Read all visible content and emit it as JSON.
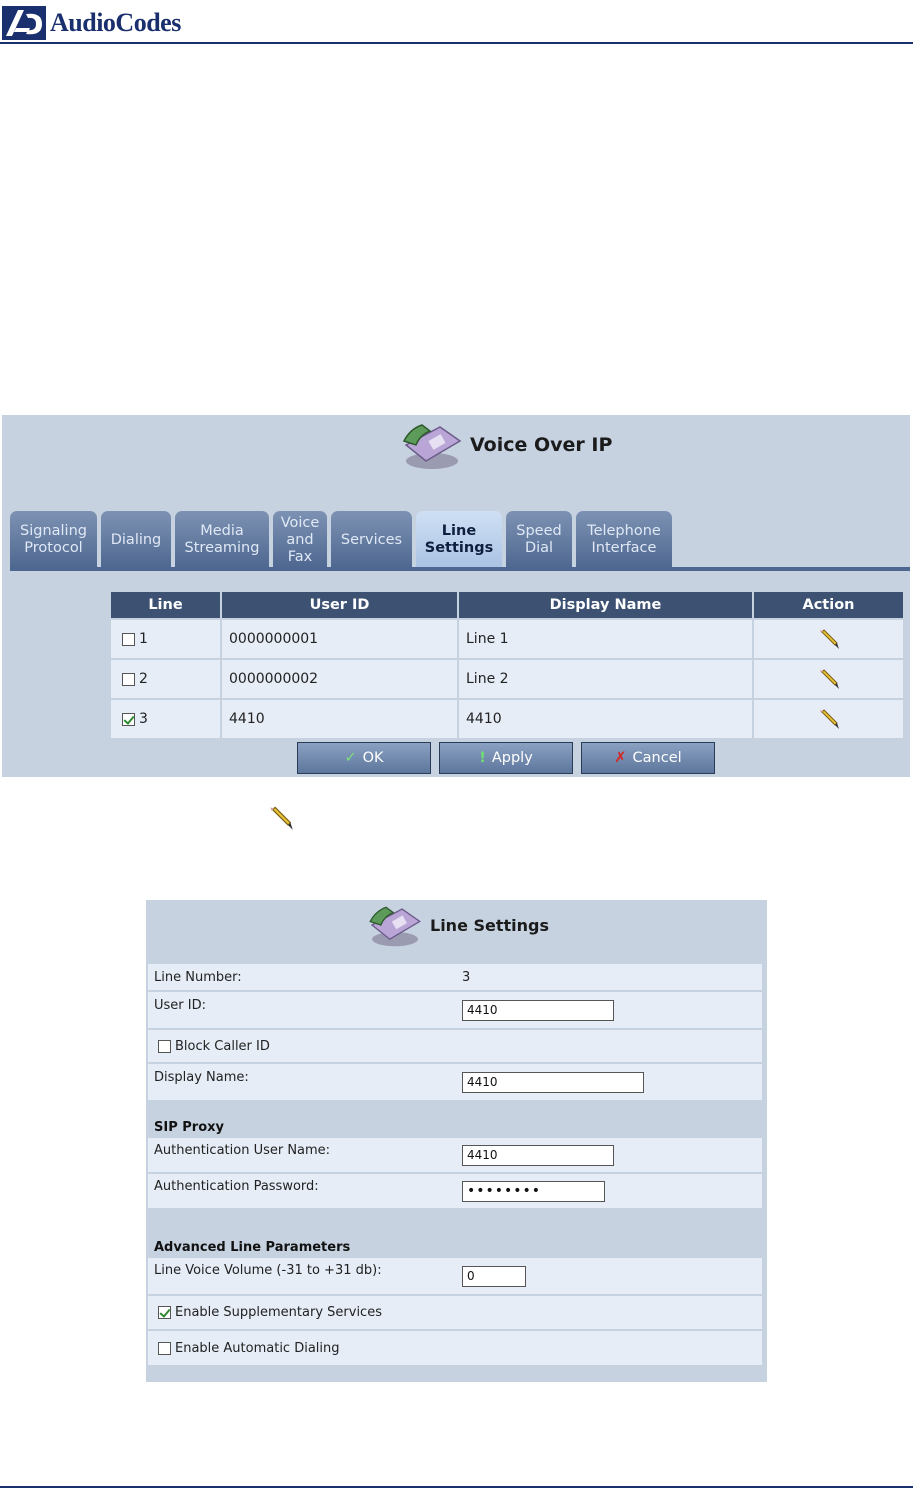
{
  "header": {
    "brand": "AudioCodes"
  },
  "voip": {
    "title": "Voice Over IP",
    "tabs": [
      {
        "label": "Signaling\nProtocol",
        "active": false
      },
      {
        "label": "Dialing",
        "active": false
      },
      {
        "label": "Media\nStreaming",
        "active": false
      },
      {
        "label": "Voice\nand\nFax",
        "active": false
      },
      {
        "label": "Services",
        "active": false
      },
      {
        "label": "Line\nSettings",
        "active": true
      },
      {
        "label": "Speed\nDial",
        "active": false
      },
      {
        "label": "Telephone\nInterface",
        "active": false
      }
    ],
    "table": {
      "headers": [
        "Line",
        "User ID",
        "Display Name",
        "Action"
      ],
      "rows": [
        {
          "line": "1",
          "checked": false,
          "user_id": "0000000001",
          "display_name": "Line 1"
        },
        {
          "line": "2",
          "checked": false,
          "user_id": "0000000002",
          "display_name": "Line 2"
        },
        {
          "line": "3",
          "checked": true,
          "user_id": "4410",
          "display_name": "4410"
        }
      ]
    },
    "buttons": {
      "ok": "OK",
      "apply": "Apply",
      "cancel": "Cancel"
    }
  },
  "line_settings": {
    "title": "Line Settings",
    "line_number_label": "Line Number:",
    "line_number_value": "3",
    "user_id_label": "User ID:",
    "user_id_value": "4410",
    "block_caller_id_label": "Block Caller ID",
    "block_caller_id_checked": false,
    "display_name_label": "Display Name:",
    "display_name_value": "4410",
    "sip_proxy_section": "SIP Proxy",
    "auth_user_label": "Authentication User Name:",
    "auth_user_value": "4410",
    "auth_password_label": "Authentication Password:",
    "auth_password_value": "••••••••",
    "advanced_section": "Advanced Line Parameters",
    "volume_label": "Line Voice Volume (-31 to +31 db):",
    "volume_value": "0",
    "supplementary_label": "Enable Supplementary Services",
    "supplementary_checked": true,
    "auto_dialing_label": "Enable Automatic Dialing",
    "auto_dialing_checked": false
  }
}
